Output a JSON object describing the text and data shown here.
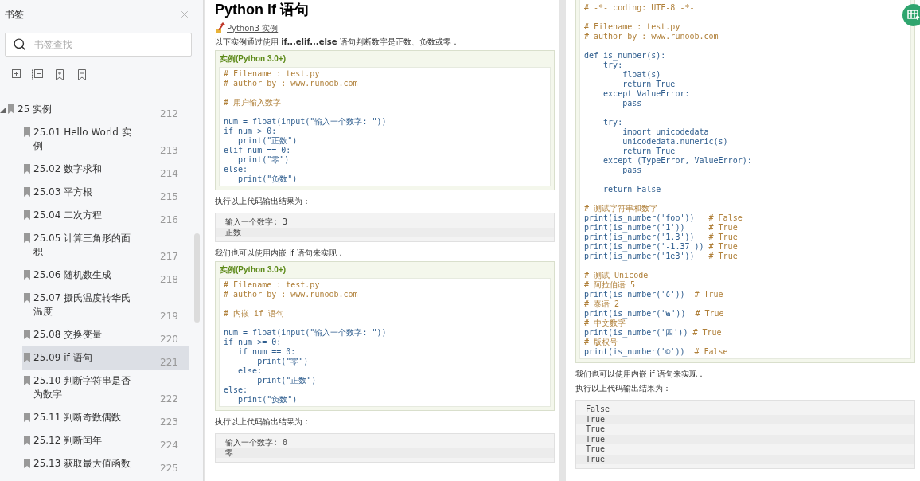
{
  "sidebar": {
    "title": "书签",
    "search": {
      "placeholder": "书签查找"
    },
    "bookmarks": [
      {
        "label": "25 实例",
        "page": "212",
        "selected": false,
        "expanded": true,
        "children": [
          {
            "label": "25.01 Hello World 实例",
            "page": "213",
            "selected": false
          },
          {
            "label": "25.02 数字求和",
            "page": "214",
            "selected": false
          },
          {
            "label": "25.03 平方根",
            "page": "215",
            "selected": false
          },
          {
            "label": "25.04 二次方程",
            "page": "216",
            "selected": false
          },
          {
            "label": "25.05 计算三角形的面积",
            "page": "217",
            "selected": false
          },
          {
            "label": "25.06 随机数生成",
            "page": "218",
            "selected": false
          },
          {
            "label": "25.07 摄氏温度转华氏温度",
            "page": "219",
            "selected": false
          },
          {
            "label": "25.08 交换变量",
            "page": "220",
            "selected": false
          },
          {
            "label": "25.09 if 语句",
            "page": "221",
            "selected": true
          },
          {
            "label": "25.10 判断字符串是否为数字",
            "page": "222",
            "selected": false
          },
          {
            "label": "25.11 判断奇数偶数",
            "page": "223",
            "selected": false
          },
          {
            "label": "25.12 判断闰年",
            "page": "224",
            "selected": false
          },
          {
            "label": "25.13 获取最大值函数",
            "page": "225",
            "selected": false
          }
        ]
      }
    ]
  },
  "pages": [
    {
      "blocks": [
        {
          "kind": "title",
          "text": "Python if 语句"
        },
        {
          "kind": "link",
          "text": "Python3 实例"
        },
        {
          "kind": "para",
          "text": "以下实例通过使用 **if...elif...else** 语句判断数字是正数、负数或零："
        },
        {
          "kind": "example",
          "header": "实例(Python 3.0+)",
          "lines": [
            {
              "comment": "# Filename : test.py"
            },
            {
              "comment": "# author by : www.runoob.com"
            },
            {
              "kind": "blank"
            },
            {
              "comment": "# 用户输入数字"
            },
            {
              "kind": "blank"
            },
            {
              "code": "num = float(input(\"输入一个数字: \"))"
            },
            {
              "code": "if num > 0:"
            },
            {
              "code": "   print(\"正数\")"
            },
            {
              "code": "elif num == 0:"
            },
            {
              "code": "   print(\"零\")"
            },
            {
              "code": "else:"
            },
            {
              "code": "   print(\"负数\")"
            }
          ]
        },
        {
          "kind": "para",
          "text": "执行以上代码输出结果为："
        },
        {
          "kind": "output",
          "lines": [
            "输入一个数字: 3",
            "正数"
          ]
        },
        {
          "kind": "para",
          "text": "我们也可以使用内嵌 if 语句来实现："
        },
        {
          "kind": "example",
          "header": "实例(Python 3.0+)",
          "lines": [
            {
              "comment": "# Filename : test.py"
            },
            {
              "comment": "# author by : www.runoob.com"
            },
            {
              "kind": "blank"
            },
            {
              "comment": "# 内嵌 if 语句"
            },
            {
              "kind": "blank"
            },
            {
              "code": "num = float(input(\"输入一个数字: \"))"
            },
            {
              "code": "if num >= 0:"
            },
            {
              "code": "   if num == 0:"
            },
            {
              "code": "       print(\"零\")"
            },
            {
              "code": "   else:"
            },
            {
              "code": "       print(\"正数\")"
            },
            {
              "code": "else:"
            },
            {
              "code": "   print(\"负数\")"
            }
          ]
        },
        {
          "kind": "para",
          "text": "执行以上代码输出结果为："
        },
        {
          "kind": "output",
          "lines": [
            "输入一个数字: 0",
            "零"
          ]
        }
      ]
    },
    {
      "blocks": [
        {
          "kind": "code",
          "lines": [
            {
              "comment": "# -*- coding: UTF-8 -*-"
            },
            {
              "kind": "blank"
            },
            {
              "comment": "# Filename : test.py"
            },
            {
              "comment": "# author by : www.runoob.com"
            },
            {
              "kind": "blank"
            },
            {
              "code": "def is_number(s):"
            },
            {
              "code": "    try:"
            },
            {
              "code": "        float(s)"
            },
            {
              "code": "        return True"
            },
            {
              "code": "    except ValueError:"
            },
            {
              "code": "        pass"
            },
            {
              "kind": "blank"
            },
            {
              "code": "    try:"
            },
            {
              "code": "        import unicodedata"
            },
            {
              "code": "        unicodedata.numeric(s)"
            },
            {
              "code": "        return True"
            },
            {
              "code": "    except (TypeError, ValueError):"
            },
            {
              "code": "        pass"
            },
            {
              "kind": "blank"
            },
            {
              "code": "    return False"
            },
            {
              "kind": "blank"
            },
            {
              "comment": "# 测试字符串和数字"
            },
            {
              "code": "print(is_number('foo'))",
              "comment": "   # False"
            },
            {
              "code": "print(is_number('1'))",
              "comment": "     # True"
            },
            {
              "code": "print(is_number('1.3'))",
              "comment": "   # True"
            },
            {
              "code": "print(is_number('-1.37'))",
              "comment": " # True"
            },
            {
              "code": "print(is_number('1e3'))",
              "comment": "   # True"
            },
            {
              "kind": "blank"
            },
            {
              "comment": "# 测试 Unicode"
            },
            {
              "comment": "# 阿拉伯语 5"
            },
            {
              "code": "print(is_number('٥'))",
              "comment": "  # True"
            },
            {
              "comment": "# 泰语 2"
            },
            {
              "code": "print(is_number('๒'))",
              "comment": "  # True"
            },
            {
              "comment": "# 中文数字"
            },
            {
              "code": "print(is_number('四'))",
              "comment": " # True"
            },
            {
              "comment": "# 版权号"
            },
            {
              "code": "print(is_number('©'))",
              "comment": "  # False"
            }
          ]
        },
        {
          "kind": "para",
          "text": "我们也可以使用内嵌 if 语句来实现："
        },
        {
          "kind": "para",
          "text": "执行以上代码输出结果为："
        },
        {
          "kind": "output",
          "lines": [
            "False",
            "True",
            "True",
            "True",
            "True",
            "True"
          ]
        }
      ]
    }
  ]
}
